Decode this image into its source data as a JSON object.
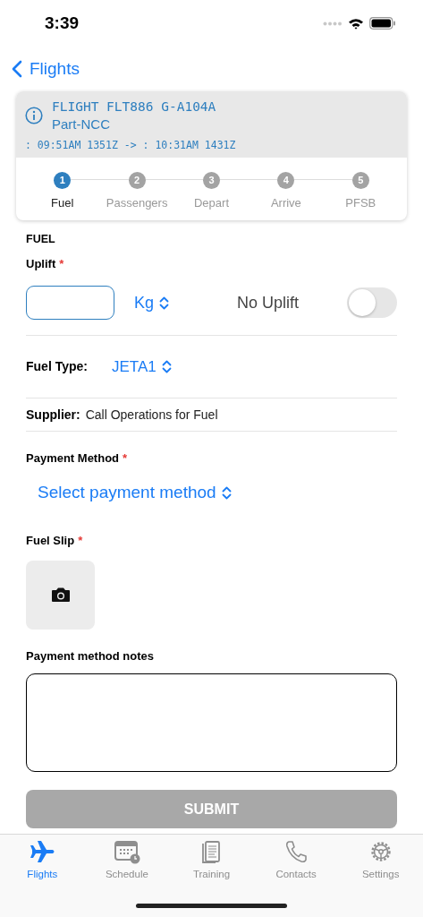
{
  "status_bar": {
    "time": "3:39"
  },
  "nav": {
    "back_label": "Flights"
  },
  "flight_card": {
    "title": "FLIGHT FLT886 G-A104A",
    "subtitle": "Part-NCC",
    "times": ": 09:51AM 1351Z -> : 10:31AM 1431Z",
    "steps": [
      {
        "number": "1",
        "label": "Fuel",
        "selected": true
      },
      {
        "number": "2",
        "label": "Passengers",
        "selected": false
      },
      {
        "number": "3",
        "label": "Depart",
        "selected": false
      },
      {
        "number": "4",
        "label": "Arrive",
        "selected": false
      },
      {
        "number": "5",
        "label": "PFSB",
        "selected": false
      }
    ]
  },
  "form": {
    "section_title": "FUEL",
    "uplift": {
      "label": "Uplift",
      "required_mark": "*",
      "unit": "Kg",
      "no_uplift_label": "No Uplift",
      "no_uplift_on": false
    },
    "fuel_type": {
      "label": "Fuel Type:",
      "value": "JETA1"
    },
    "supplier": {
      "label": "Supplier:",
      "value": "Call Operations for Fuel"
    },
    "payment_method": {
      "label": "Payment Method",
      "required_mark": "*",
      "placeholder": "Select payment method"
    },
    "fuel_slip": {
      "label": "Fuel Slip",
      "required_mark": "*"
    },
    "notes": {
      "label": "Payment method notes"
    },
    "submit": {
      "label": "SUBMIT",
      "disabled": true
    }
  },
  "tab_bar": [
    {
      "label": "Flights",
      "kind": "plane",
      "selected": true
    },
    {
      "label": "Schedule",
      "kind": "calendar",
      "selected": false
    },
    {
      "label": "Training",
      "kind": "document",
      "selected": false
    },
    {
      "label": "Contacts",
      "kind": "phone",
      "selected": false
    },
    {
      "label": "Settings",
      "kind": "gear",
      "selected": false
    }
  ]
}
